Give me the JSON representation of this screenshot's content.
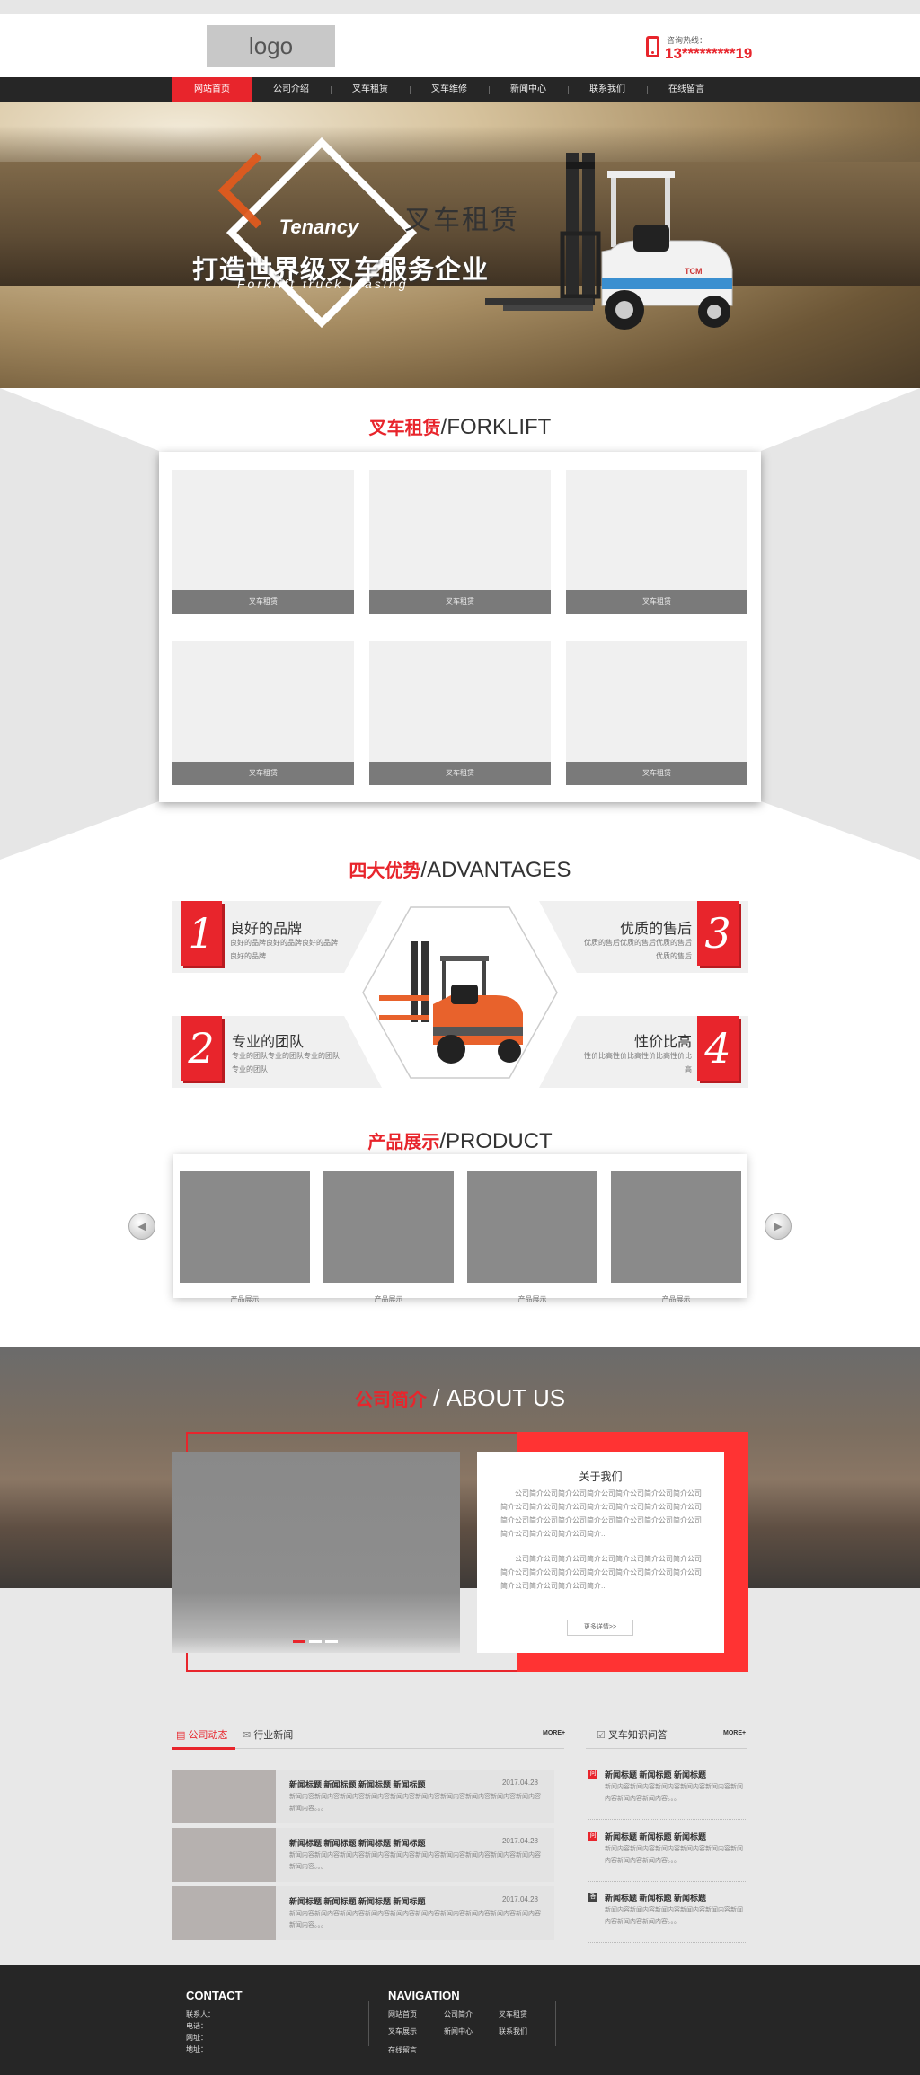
{
  "header": {
    "logo": "logo",
    "hotline_label": "咨询热线：",
    "hotline_number": "13*********19"
  },
  "nav": [
    "网站首页",
    "公司介绍",
    "叉车租赁",
    "叉车维修",
    "新闻中心",
    "联系我们",
    "在线留言"
  ],
  "banner": {
    "badge": "Tenancy",
    "title": "叉车租赁",
    "headline": "打造世界级叉车服务企业",
    "sub": "Forklift truck leasing"
  },
  "forklift_section": {
    "title_cn": "叉车租赁",
    "title_en": "/FORKLIFT",
    "cards": [
      "叉车租赁",
      "叉车租赁",
      "叉车租赁",
      "叉车租赁",
      "叉车租赁",
      "叉车租赁"
    ]
  },
  "advantages": {
    "title_cn": "四大优势",
    "title_en": "/ADVANTAGES",
    "items": [
      {
        "num": "1",
        "title": "良好的品牌",
        "desc": "良好的品牌良好的品牌良好的品牌良好的品牌"
      },
      {
        "num": "3",
        "title": "优质的售后",
        "desc": "优质的售后优质的售后优质的售后优质的售后"
      },
      {
        "num": "2",
        "title": "专业的团队",
        "desc": "专业的团队专业的团队专业的团队专业的团队"
      },
      {
        "num": "4",
        "title": "性价比高",
        "desc": "性价比高性价比高性价比高性价比高"
      }
    ]
  },
  "products": {
    "title_cn": "产品展示",
    "title_en": "/PRODUCT",
    "items": [
      "产品展示",
      "产品展示",
      "产品展示",
      "产品展示"
    ]
  },
  "about": {
    "title_cn": "公司简介",
    "title_en": "/ ABOUT US",
    "card_title": "关于我们",
    "p1": "公司简介公司简介公司简介公司简介公司简介公司简介公司简介公司简介公司简介公司简介公司简介公司简介公司简介公司简介公司简介公司简介公司简介公司简介公司简介公司简介公司简介公司简介公司简介公司简介...",
    "p2": "公司简介公司简介公司简介公司简介公司简介公司简介公司简介公司简介公司简介公司简介公司简介公司简介公司简介公司简介公司简介公司简介公司简介...",
    "button": "更多详情>>"
  },
  "news": {
    "tab_active": "公司动态",
    "tab_other": "行业新闻",
    "more": "MORE+",
    "items": [
      {
        "title": "新闻标题  新闻标题  新闻标题  新闻标题",
        "date": "2017.04.28",
        "text": "新闻内容新闻内容新闻内容新闻内容新闻内容新闻内容新闻内容新闻内容新闻内容新闻内容新闻内容。。。"
      },
      {
        "title": "新闻标题  新闻标题  新闻标题  新闻标题",
        "date": "2017.04.28",
        "text": "新闻内容新闻内容新闻内容新闻内容新闻内容新闻内容新闻内容新闻内容新闻内容新闻内容新闻内容。。。"
      },
      {
        "title": "新闻标题  新闻标题  新闻标题  新闻标题",
        "date": "2017.04.28",
        "text": "新闻内容新闻内容新闻内容新闻内容新闻内容新闻内容新闻内容新闻内容新闻内容新闻内容新闻内容。。。"
      }
    ]
  },
  "qa": {
    "title": "叉车知识问答",
    "more": "MORE+",
    "items": [
      {
        "icon": "问",
        "title": "新闻标题  新闻标题  新闻标题",
        "text": "新闻内容新闻内容新闻内容新闻内容新闻内容新闻内容新闻内容新闻内容。。。"
      },
      {
        "icon": "问",
        "title": "新闻标题  新闻标题  新闻标题",
        "text": "新闻内容新闻内容新闻内容新闻内容新闻内容新闻内容新闻内容新闻内容。。。"
      },
      {
        "icon": "答",
        "title": "新闻标题  新闻标题  新闻标题",
        "text": "新闻内容新闻内容新闻内容新闻内容新闻内容新闻内容新闻内容新闻内容。。。"
      }
    ]
  },
  "footer": {
    "contact_title": "CONTACT",
    "contact": [
      "联系人：",
      "电话：",
      "网址：",
      "地址："
    ],
    "nav_title": "NAVIGATION",
    "nav": [
      "网站首页",
      "公司简介",
      "叉车租赁",
      "叉车展示",
      "新闻中心",
      "联系我们",
      "在线留言"
    ]
  },
  "colors": {
    "accent": "#e8252c",
    "dark": "#262626"
  }
}
